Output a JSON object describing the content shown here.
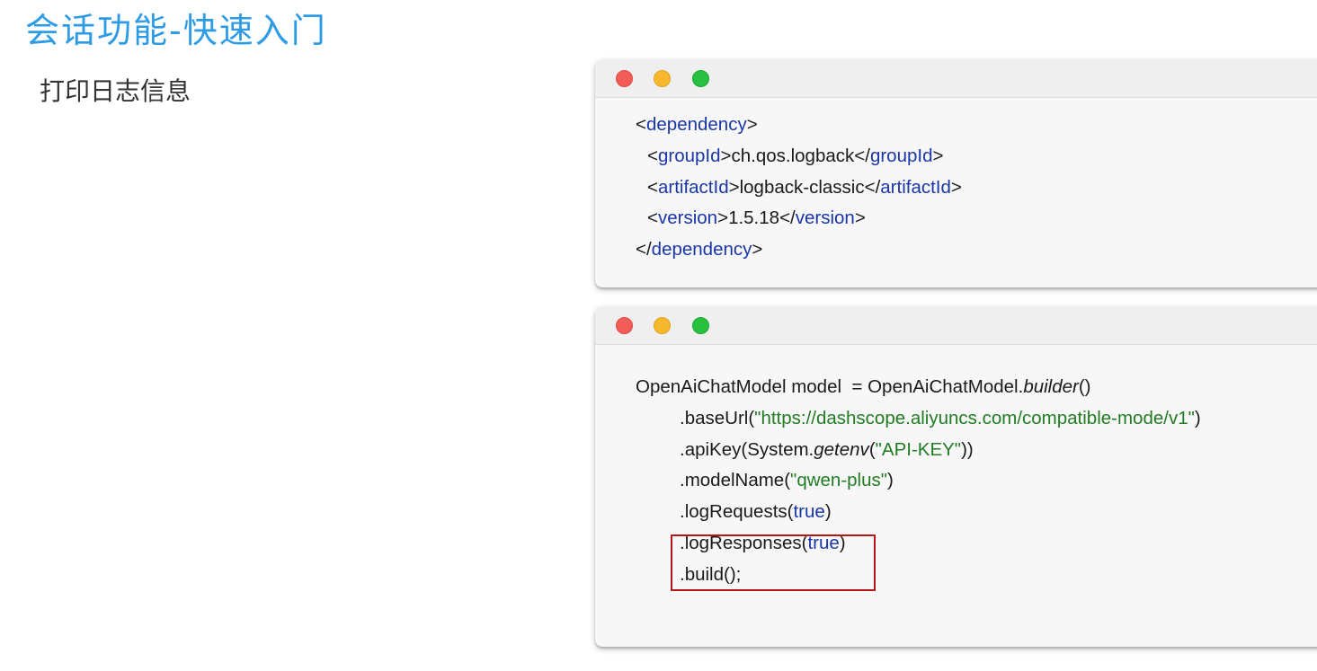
{
  "slide": {
    "title": "会话功能-快速入门",
    "subtitle": "打印日志信息"
  },
  "colors": {
    "title": "#2E9BE6",
    "tag": "#1A36A8",
    "string": "#217C23",
    "keyword": "#1A36A8",
    "highlight_border": "#B4161B",
    "window_bg": "#F6F7F6"
  },
  "window_controls": [
    "close-dot-icon",
    "minimize-dot-icon",
    "maximize-dot-icon"
  ],
  "xml_snippet": {
    "dependency_tag": "dependency",
    "group_tag": "groupId",
    "group_value": "ch.qos.logback",
    "artifact_tag": "artifactId",
    "artifact_value": "logback-classic",
    "version_tag": "version",
    "version_value": "1.5.18"
  },
  "java_snippet": {
    "line1_prefix": "OpenAiChatModel model  = OpenAiChatModel.",
    "line1_method": "builder",
    "line1_suffix": "()",
    "base_url_call": ".baseUrl(",
    "base_url_value": "\"https://dashscope.aliyuncs.com/compatible-mode/v1\"",
    "api_key_call": ".apiKey(System.",
    "api_key_method": "getenv",
    "api_key_value": "\"API-KEY\"",
    "model_name_call": ".modelName(",
    "model_name_value": "\"qwen-plus\"",
    "log_requests_call": ".logRequests(",
    "log_responses_call": ".logResponses(",
    "true_literal": "true",
    "build_call": ".build();"
  }
}
